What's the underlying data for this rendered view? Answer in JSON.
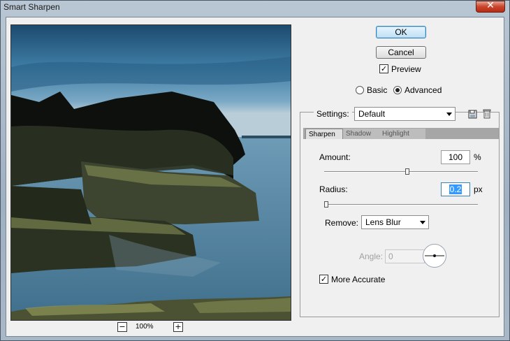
{
  "window": {
    "title": "Smart Sharpen",
    "close_glyph": "✕"
  },
  "preview": {
    "zoom_out": "−",
    "zoom_in": "+",
    "zoom_level": "100%"
  },
  "buttons": {
    "ok": "OK",
    "cancel": "Cancel"
  },
  "preview_toggle": {
    "label": "Preview",
    "checked": true
  },
  "mode": {
    "basic": "Basic",
    "advanced": "Advanced",
    "selected": "Advanced"
  },
  "settings": {
    "label": "Settings:",
    "value": "Default"
  },
  "tabs": [
    {
      "label": "Sharpen",
      "active": true
    },
    {
      "label": "Shadow",
      "active": false
    },
    {
      "label": "Highlight",
      "active": false
    }
  ],
  "amount": {
    "label": "Amount:",
    "value": "100",
    "unit": "%"
  },
  "radius": {
    "label": "Radius:",
    "value": "0.2",
    "unit": "px"
  },
  "remove": {
    "label": "Remove:",
    "value": "Lens Blur"
  },
  "angle": {
    "label": "Angle:",
    "value": "0",
    "unit": "°"
  },
  "more_accurate": {
    "label": "More Accurate",
    "checked": true
  },
  "check_glyph": "✓",
  "colors": {
    "sky": "#2f6a92",
    "water": "#5f8fab",
    "rock": "#1e2418",
    "moss": "#6b7443"
  }
}
